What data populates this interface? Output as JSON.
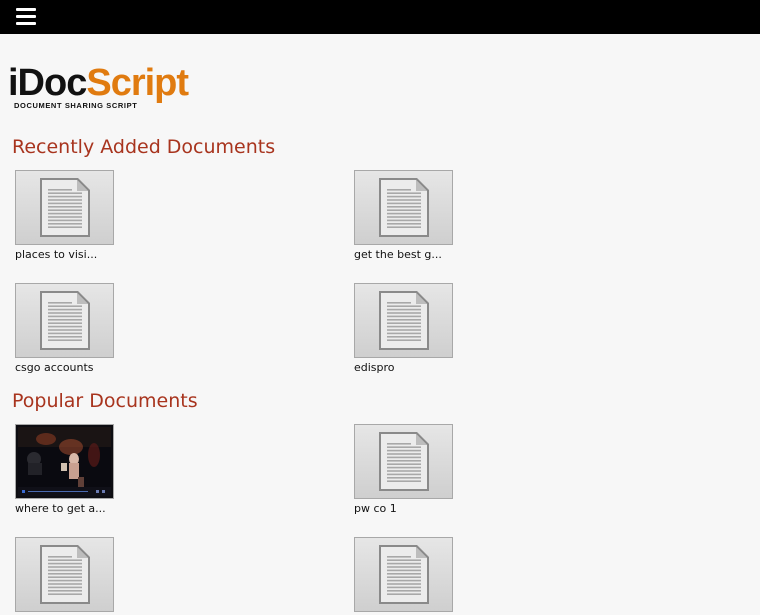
{
  "header": {
    "menu_icon": "hamburger-menu-icon"
  },
  "logo": {
    "main_dark": "iDoc",
    "main_accent": "Script",
    "tagline": "DOCUMENT SHARING SCRIPT",
    "colors": {
      "dark": "#111111",
      "accent": "#e07b10"
    }
  },
  "recent": {
    "title": "Recently Added Documents",
    "items": [
      {
        "label": "places to visi...",
        "thumb": "document-icon"
      },
      {
        "label": "get the best g...",
        "thumb": "document-icon"
      },
      {
        "label": "csgo accounts",
        "thumb": "document-icon"
      },
      {
        "label": "edispro",
        "thumb": "document-icon"
      }
    ]
  },
  "popular": {
    "title": "Popular Documents",
    "items": [
      {
        "label": "where to get a...",
        "thumb": "video-thumbnail"
      },
      {
        "label": "pw co 1",
        "thumb": "document-icon"
      },
      {
        "label": "",
        "thumb": "document-icon"
      },
      {
        "label": "",
        "thumb": "document-icon"
      }
    ]
  },
  "colors": {
    "section_title": "#a8341e",
    "topbar": "#000000"
  }
}
